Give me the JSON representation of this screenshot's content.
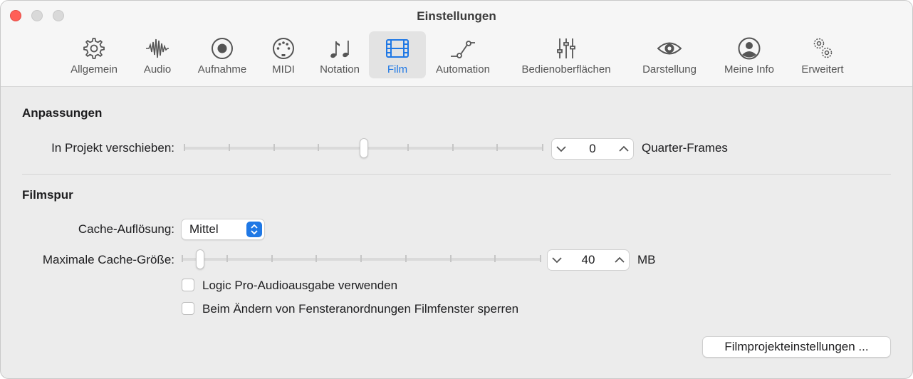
{
  "window": {
    "title": "Einstellungen"
  },
  "tabs": [
    {
      "label": "Allgemein",
      "icon": "gear-icon"
    },
    {
      "label": "Audio",
      "icon": "waveform-icon"
    },
    {
      "label": "Aufnahme",
      "icon": "record-icon"
    },
    {
      "label": "MIDI",
      "icon": "midi-connector-icon"
    },
    {
      "label": "Notation",
      "icon": "music-notes-icon"
    },
    {
      "label": "Film",
      "icon": "film-icon",
      "selected": true
    },
    {
      "label": "Automation",
      "icon": "automation-curve-icon"
    },
    {
      "label": "Bedienoberflächen",
      "icon": "sliders-icon"
    },
    {
      "label": "Darstellung",
      "icon": "eye-icon"
    },
    {
      "label": "Meine Info",
      "icon": "person-icon"
    },
    {
      "label": "Erweitert",
      "icon": "gears-icon"
    }
  ],
  "adjustments": {
    "title": "Anpassungen",
    "project_offset": {
      "label": "In Projekt verschieben:",
      "value": "0",
      "unit": "Quarter-Frames",
      "slider_position": 0.5
    }
  },
  "movie_track": {
    "title": "Filmspur",
    "cache_resolution": {
      "label": "Cache-Auflösung:",
      "value": "Mittel"
    },
    "max_cache_size": {
      "label": "Maximale Cache-Größe:",
      "value": "40",
      "unit": "MB",
      "slider_position": 0.04
    },
    "checkboxes": [
      {
        "label": "Logic Pro-Audioausgabe verwenden",
        "checked": false
      },
      {
        "label": "Beim Ändern von Fensteranordnungen Filmfenster sperren",
        "checked": false
      }
    ],
    "project_settings_button": "Filmprojekteinstellungen ..."
  },
  "colors": {
    "accent": "#1f78e5",
    "close": "#ff5f57"
  }
}
